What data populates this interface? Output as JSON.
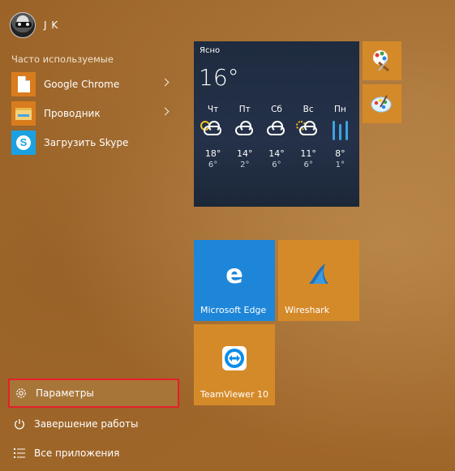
{
  "user": {
    "name": "J K"
  },
  "most_used": {
    "title": "Часто используемые",
    "items": [
      {
        "label": "Google Chrome",
        "icon": "chrome-icon",
        "has_submenu": true
      },
      {
        "label": "Проводник",
        "icon": "file-explorer-icon",
        "has_submenu": true
      },
      {
        "label": "Загрузить Skype",
        "icon": "skype-icon",
        "has_submenu": false
      }
    ]
  },
  "bottom": {
    "settings": "Параметры",
    "shutdown": "Завершение работы",
    "all_apps": "Все приложения"
  },
  "weather": {
    "city": "Ясно",
    "temp": "16°",
    "days": [
      {
        "day": "Чт",
        "icon": "partly-cloudy-icon",
        "hi": "18°",
        "lo": "6°"
      },
      {
        "day": "Пт",
        "icon": "cloudy-icon",
        "hi": "14°",
        "lo": "2°"
      },
      {
        "day": "Сб",
        "icon": "cloudy-icon",
        "hi": "14°",
        "lo": "6°"
      },
      {
        "day": "Вс",
        "icon": "showers-icon",
        "hi": "11°",
        "lo": "6°"
      },
      {
        "day": "Пн",
        "icon": "rain-icon",
        "hi": "8°",
        "lo": "1°"
      }
    ]
  },
  "tiles": {
    "edge": "Microsoft Edge",
    "wireshark": "Wireshark",
    "teamviewer": "TeamViewer 10"
  },
  "colors": {
    "accent_tile": "#d58a2a",
    "edge_blue": "#1e86d8",
    "highlight_border": "#e5202a"
  }
}
